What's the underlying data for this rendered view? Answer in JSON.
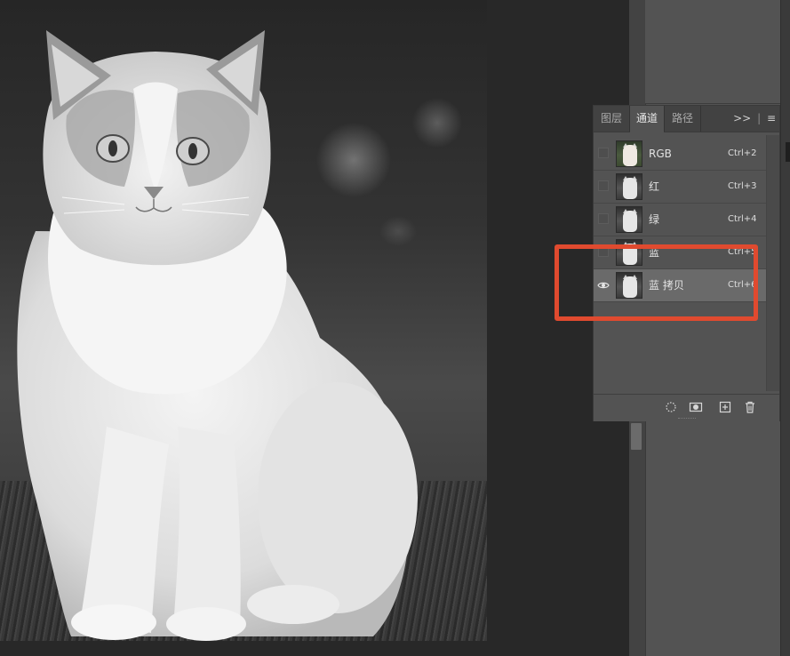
{
  "canvas": {
    "image_subject": "ragdoll-cat-grayscale"
  },
  "channels_panel": {
    "tabs": [
      {
        "label": "图层",
        "active": false
      },
      {
        "label": "通道",
        "active": true
      },
      {
        "label": "路径",
        "active": false
      }
    ],
    "menu": {
      "expand": ">>",
      "separator": "|",
      "menu": "≡"
    },
    "channels": [
      {
        "name": "RGB",
        "shortcut": "Ctrl+2",
        "visible": false,
        "selected": false,
        "thumb": "color"
      },
      {
        "name": "红",
        "shortcut": "Ctrl+3",
        "visible": false,
        "selected": false,
        "thumb": "gray"
      },
      {
        "name": "绿",
        "shortcut": "Ctrl+4",
        "visible": false,
        "selected": false,
        "thumb": "gray"
      },
      {
        "name": "蓝",
        "shortcut": "Ctrl+5",
        "visible": false,
        "selected": false,
        "thumb": "gray"
      },
      {
        "name": "蓝 拷贝",
        "shortcut": "Ctrl+6",
        "visible": true,
        "selected": true,
        "thumb": "gray"
      }
    ],
    "footer_buttons": [
      "load-selection-icon",
      "save-selection-as-channel-icon",
      "new-channel-icon",
      "delete-channel-icon"
    ]
  },
  "colors": {
    "annotation": "#e04a2f",
    "panel_bg": "#535353",
    "selected_row": "#6a6a6a"
  }
}
